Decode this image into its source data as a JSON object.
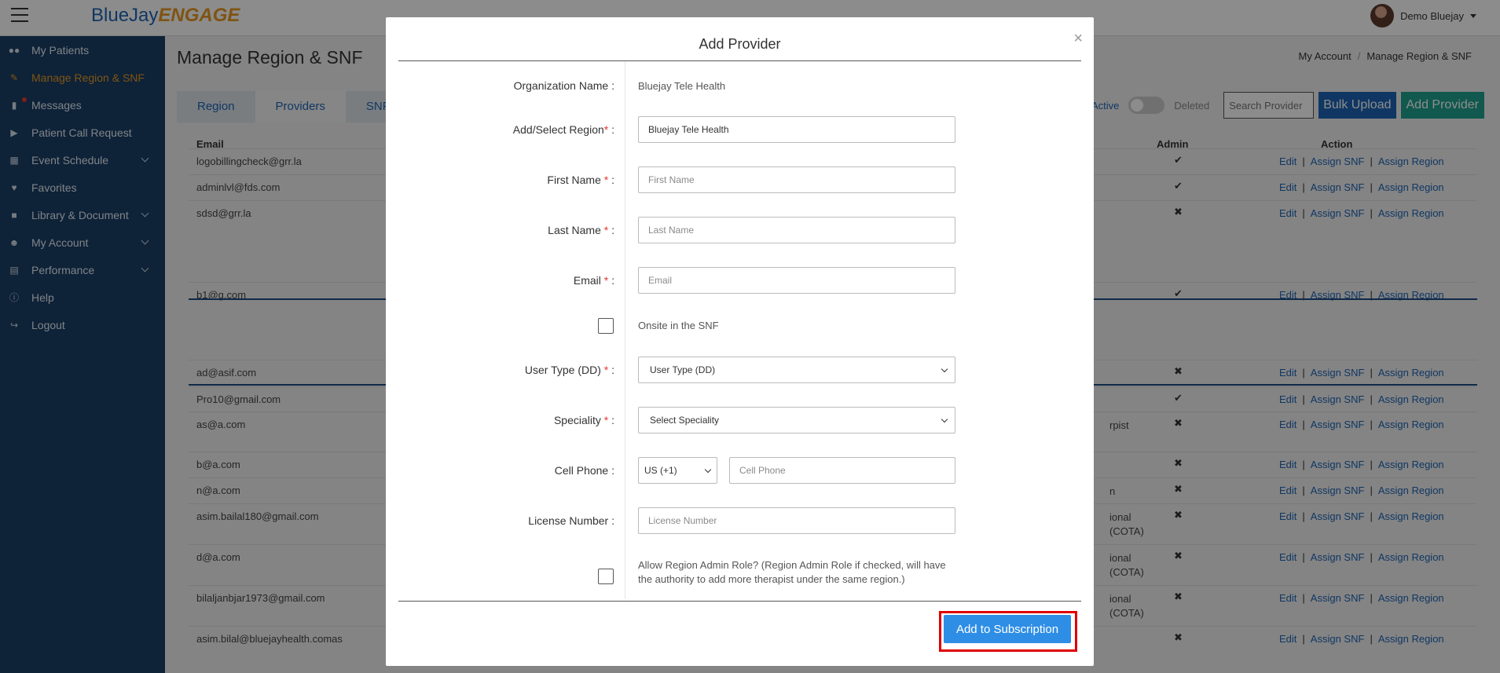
{
  "header": {
    "logo_part1": "BlueJay",
    "logo_part2": "ENGAGE",
    "user_name": "Demo Bluejay"
  },
  "sidebar": {
    "items": [
      {
        "label": "My Patients",
        "icon": "users-icon"
      },
      {
        "label": "Manage Region & SNF",
        "icon": "clipboard-icon",
        "active": true
      },
      {
        "label": "Messages",
        "icon": "chat-icon"
      },
      {
        "label": "Patient Call Request",
        "icon": "video-icon"
      },
      {
        "label": "Event Schedule",
        "icon": "calendar-icon"
      },
      {
        "label": "Favorites",
        "icon": "heart-icon"
      },
      {
        "label": "Library & Document",
        "icon": "library-icon"
      },
      {
        "label": "My Account",
        "icon": "account-icon"
      },
      {
        "label": "Performance",
        "icon": "chart-icon"
      },
      {
        "label": "Help",
        "icon": "info-icon"
      },
      {
        "label": "Logout",
        "icon": "logout-icon"
      }
    ]
  },
  "page": {
    "title": "Manage Region & SNF",
    "breadcrumb": [
      "My Account",
      "Manage Region & SNF"
    ],
    "tabs": [
      "Region",
      "Providers",
      "SNF"
    ],
    "active_label": "Active",
    "deleted_label": "Deleted",
    "search_placeholder": "Search Provider",
    "bulk_upload": "Bulk Upload",
    "add_provider": "Add Provider"
  },
  "table": {
    "headers": {
      "email": "Email",
      "admin": "Admin",
      "action": "Action"
    },
    "action_links": [
      "Edit",
      "Assign SNF",
      "Assign Region"
    ],
    "rows": [
      {
        "email": "logobillingcheck@grr.la",
        "role": "",
        "admin": "✔"
      },
      {
        "email": "adminlvl@fds.com",
        "role": "",
        "admin": "✔"
      },
      {
        "email": "sdsd@grr.la",
        "role": "",
        "admin": "✖"
      },
      {
        "email": "b1@g.com",
        "role": "",
        "admin": "✔"
      },
      {
        "email": "ad@asif.com",
        "role": "",
        "admin": "✖"
      },
      {
        "email": "Pro10@gmail.com",
        "role": "",
        "admin": "✔"
      },
      {
        "email": "as@a.com",
        "role": "rpist",
        "admin": "✖"
      },
      {
        "email": "b@a.com",
        "role": "",
        "admin": "✖"
      },
      {
        "email": "n@a.com",
        "role": "n",
        "admin": "✖"
      },
      {
        "email": "asim.bailal180@gmail.com",
        "role": "ional\n(COTA)",
        "admin": "✖"
      },
      {
        "email": "d@a.com",
        "role": "ional\n(COTA)",
        "admin": "✖"
      },
      {
        "email": "bilaljanbjar1973@gmail.com",
        "role": "ional\n(COTA)",
        "admin": "✖"
      },
      {
        "email": "asim.bilal@bluejayhealth.comas",
        "role": "",
        "admin": "✖"
      }
    ]
  },
  "modal": {
    "title": "Add Provider",
    "close": "×",
    "org_label": "Organization Name :",
    "org_value": "Bluejay Tele Health",
    "region_label": "Add/Select Region",
    "region_value": "Bluejay Tele Health",
    "first_label": "First Name ",
    "first_placeholder": "First Name",
    "last_label": "Last Name ",
    "last_placeholder": "Last Name",
    "email_label": "Email ",
    "email_placeholder": "Email",
    "onsite_label": "Onsite in the SNF",
    "usertype_label": "User Type (DD) ",
    "usertype_value": "User Type (DD)",
    "speciality_label": "Speciality ",
    "speciality_value": "Select Speciality",
    "cell_label": "Cell Phone :",
    "country_value": "US (+1)",
    "cell_placeholder": "Cell Phone",
    "license_label": "License Number :",
    "license_placeholder": "License Number",
    "admin_role_label": "Allow Region Admin Role? (Region Admin Role if checked, will have the authority to add more therapist under the same region.)",
    "required_mark": "*",
    "colon": " :",
    "submit": "Add to Subscription"
  },
  "colors": {
    "sidebar_bg": "#1a3f66",
    "accent_blue": "#1e64b4",
    "active_orange": "#e79a24",
    "add_green": "#1fa18f",
    "submit_blue": "#2e8ee6",
    "highlight_red": "#e00000"
  }
}
